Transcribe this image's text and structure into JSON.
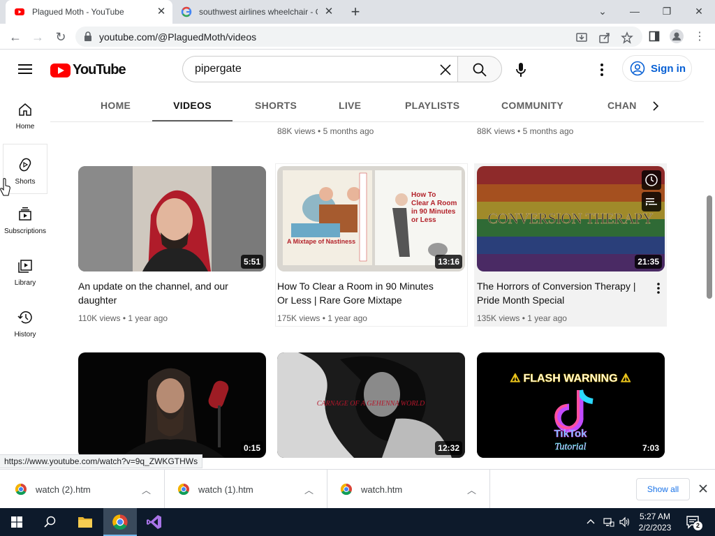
{
  "browser": {
    "tabs": [
      {
        "title": "Plagued Moth - YouTube",
        "active": true
      },
      {
        "title": "southwest airlines wheelchair - G",
        "active": false
      }
    ],
    "url": "youtube.com/@PlaguedMoth/videos",
    "status_url": "https://www.youtube.com/watch?v=9q_ZWKGTHWs"
  },
  "youtube": {
    "logo_text": "YouTube",
    "search_query": "pipergate",
    "signin_label": "Sign in",
    "sidebar": [
      {
        "label": "Home",
        "icon": "home-icon"
      },
      {
        "label": "Shorts",
        "icon": "shorts-icon"
      },
      {
        "label": "Subscriptions",
        "icon": "subscriptions-icon"
      },
      {
        "label": "Library",
        "icon": "library-icon"
      },
      {
        "label": "History",
        "icon": "history-icon"
      }
    ],
    "channel_tabs": [
      "HOME",
      "VIDEOS",
      "SHORTS",
      "LIVE",
      "PLAYLISTS",
      "COMMUNITY",
      "CHAN"
    ],
    "active_tab": "VIDEOS",
    "prev_row_meta": [
      {
        "views": "88K views",
        "age": "5 months ago"
      },
      {
        "views": "88K views",
        "age": "5 months ago"
      }
    ],
    "videos": [
      {
        "title": "An update on the channel, and our daughter",
        "duration": "5:51",
        "views": "110K views",
        "age": "1 year ago"
      },
      {
        "title": "How To Clear a Room in 90 Minutes Or Less | Rare Gore Mixtape",
        "duration": "13:16",
        "views": "175K views",
        "age": "1 year ago",
        "thumb_text_1": "How To Clear A Room in 90 Minutes or Less",
        "thumb_text_2": "A Mixtape of Nastiness"
      },
      {
        "title": "The Horrors of Conversion Therapy | Pride Month Special",
        "duration": "21:35",
        "views": "135K views",
        "age": "1 year ago",
        "thumb_text": "CONVERSION THERAPY"
      },
      {
        "title": "",
        "duration": "0:15"
      },
      {
        "title": "",
        "duration": "12:32",
        "thumb_text": "CARNAGE OF A GEHENNA WORLD"
      },
      {
        "title": "",
        "duration": "7:03",
        "thumb_text_1": "⚠ FLASH WARNING ⚠",
        "thumb_text_2": "TikTok",
        "thumb_text_3": "Tutorial"
      }
    ]
  },
  "downloads": [
    {
      "name": "watch (2).htm"
    },
    {
      "name": "watch (1).htm"
    },
    {
      "name": "watch.htm"
    }
  ],
  "downloads_show_all": "Show all",
  "taskbar": {
    "time": "5:27 AM",
    "date": "2/2/2023",
    "notifications": "2"
  },
  "colors": {
    "youtube_red": "#ff0000",
    "link_blue": "#065fd4",
    "taskbar_bg": "#0d1a2b"
  }
}
